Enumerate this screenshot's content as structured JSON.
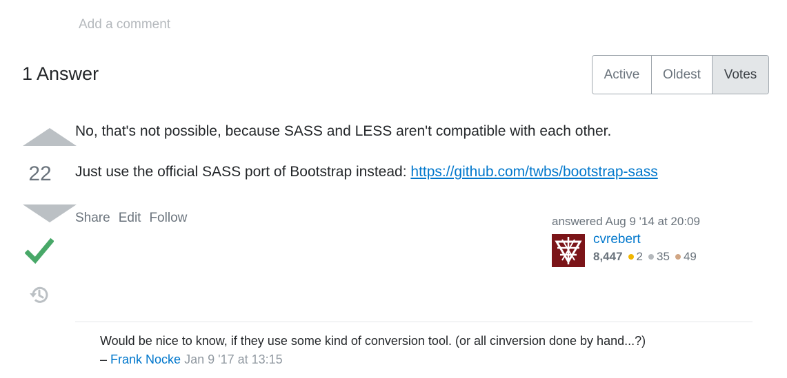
{
  "add_comment": "Add a comment",
  "answers_header": "1 Answer",
  "sort_tabs": [
    {
      "label": "Active",
      "active": false
    },
    {
      "label": "Oldest",
      "active": false
    },
    {
      "label": "Votes",
      "active": true
    }
  ],
  "answer": {
    "vote_count": "22",
    "accepted": true,
    "body": {
      "p1": "No, that's not possible, because SASS and LESS aren't compatible with each other.",
      "p2_text": "Just use the official SASS port of Bootstrap instead: ",
      "p2_link": "https://github.com/twbs/bootstrap-sass"
    },
    "menu": {
      "share": "Share",
      "edit": "Edit",
      "follow": "Follow"
    },
    "user": {
      "action_time": "answered Aug 9 '14 at 20:09",
      "name": "cvrebert",
      "reputation": "8,447",
      "badges": {
        "gold": "2",
        "silver": "35",
        "bronze": "49"
      },
      "avatar_color": "#7b1418"
    }
  },
  "comments": [
    {
      "text": "Would be nice to know, if they use some kind of conversion tool. (or all cinversion done by hand...?)",
      "dash": "–",
      "user": "Frank Nocke",
      "date": "Jan 9 '17 at 13:15"
    }
  ],
  "colors": {
    "link": "#0077cc",
    "accepted": "#48a868",
    "vote_arrow": "#bbc0c4",
    "gold": "#f1b600",
    "silver": "#b4b8bc",
    "bronze": "#d1a684"
  }
}
